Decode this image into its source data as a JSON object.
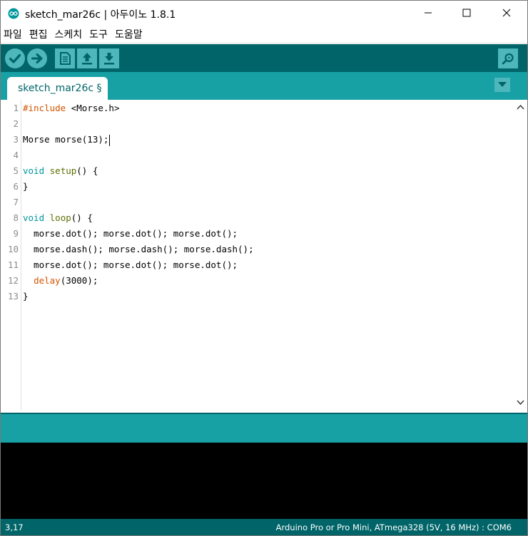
{
  "window": {
    "title": "sketch_mar26c | 아두이노 1.8.1",
    "app_icon": "arduino-logo-icon",
    "controls": [
      "minimize-icon",
      "maximize-icon",
      "close-icon"
    ]
  },
  "menu": {
    "items": [
      "파일",
      "편집",
      "스케치",
      "도구",
      "도움말"
    ]
  },
  "toolbar": {
    "buttons": [
      "verify-icon",
      "upload-icon",
      "new-icon",
      "open-icon",
      "save-icon"
    ],
    "serial_monitor": "serial-monitor-icon"
  },
  "tabs": {
    "items": [
      {
        "label": "sketch_mar26c §"
      }
    ],
    "menu_icon": "tab-menu-triangle-icon"
  },
  "editor": {
    "cursor": "3,17",
    "lines": [
      {
        "no": "1",
        "text": "#include <Morse.h>"
      },
      {
        "no": "2",
        "text": ""
      },
      {
        "no": "3",
        "text": "Morse morse(13);"
      },
      {
        "no": "4",
        "text": ""
      },
      {
        "no": "5",
        "text": "void setup() {"
      },
      {
        "no": "6",
        "text": "}"
      },
      {
        "no": "7",
        "text": ""
      },
      {
        "no": "8",
        "text": "void loop() {"
      },
      {
        "no": "9",
        "text": "  morse.dot(); morse.dot(); morse.dot();"
      },
      {
        "no": "10",
        "text": "  morse.dash(); morse.dash(); morse.dash();"
      },
      {
        "no": "11",
        "text": "  morse.dot(); morse.dot(); morse.dot();"
      },
      {
        "no": "12",
        "text": "  delay(3000);"
      },
      {
        "no": "13",
        "text": "}"
      }
    ],
    "tokens": {
      "preprocessor": "#include",
      "include_target": " <Morse.h>",
      "type_void": "void",
      "fn_setup": "setup",
      "fn_loop": "loop",
      "fn_delay": "delay"
    }
  },
  "status": {
    "line_col": "3,17",
    "board": "Arduino Pro or Pro Mini, ATmega328 (5V, 16 MHz) : COM6"
  },
  "colors": {
    "toolbar_bg": "#006468",
    "tabbar_bg": "#17a1a5",
    "button_bg": "#4db7bb",
    "console_bg": "#000000",
    "keyword_orange": "#d35400",
    "keyword_teal": "#00979c",
    "preprocessor": "#5e6d03"
  }
}
